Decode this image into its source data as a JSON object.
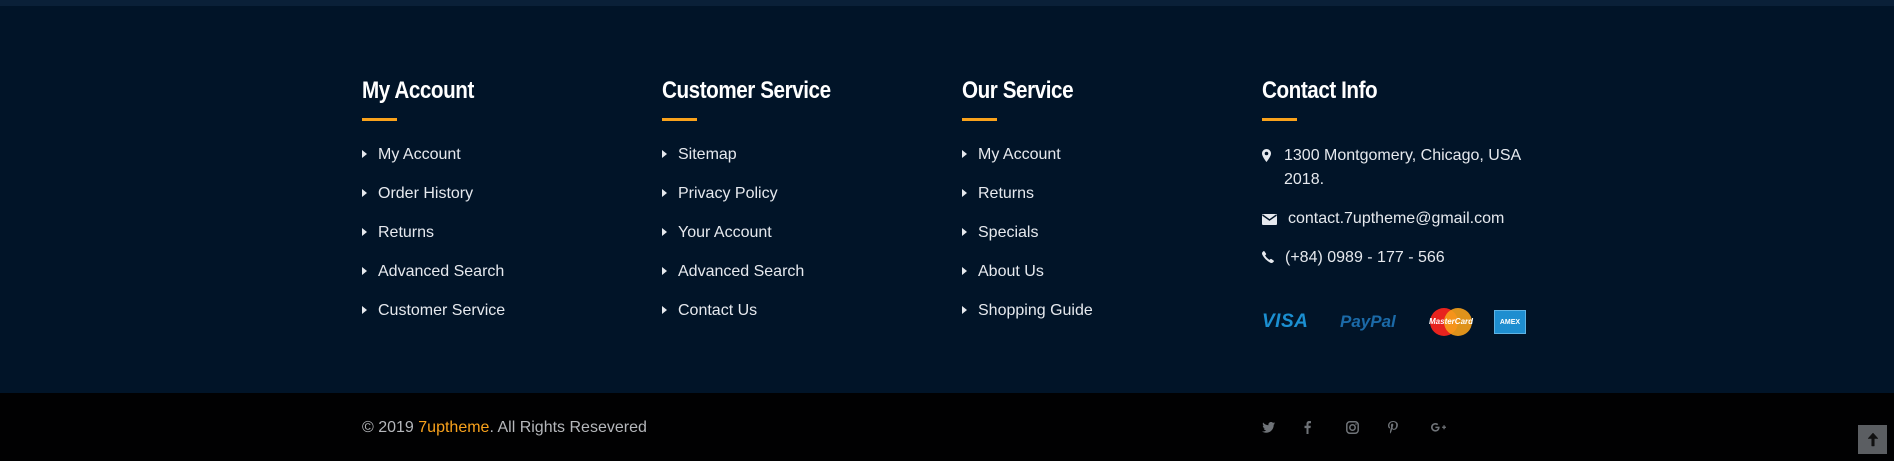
{
  "columns": [
    {
      "title": "My Account",
      "links": [
        "My Account",
        "Order History",
        "Returns",
        "Advanced Search",
        "Customer Service"
      ]
    },
    {
      "title": "Customer Service",
      "links": [
        "Sitemap",
        "Privacy Policy",
        "Your Account",
        "Advanced Search",
        "Contact Us"
      ]
    },
    {
      "title": "Our Service",
      "links": [
        "My Account",
        "Returns",
        "Specials",
        "About Us",
        "Shopping Guide"
      ]
    }
  ],
  "contact": {
    "title": "Contact Info",
    "address_line1": "1300 Montgomery, Chicago, USA",
    "address_line2": "2018.",
    "email": "contact.7uptheme@gmail.com",
    "phone": "(+84) 0989 - 177 - 566"
  },
  "payments": {
    "visa": "VISA",
    "paypal": "PayPal",
    "mastercard": "MasterCard",
    "amex": "AMEX"
  },
  "footer": {
    "copyright_prefix": "© 2019 ",
    "brand": "7uptheme",
    "copyright_suffix": ". All Rights Resevered"
  },
  "social_icons": [
    "twitter-icon",
    "facebook-icon",
    "instagram-icon",
    "pinterest-icon",
    "google-plus-icon"
  ],
  "colors": {
    "background": "#011428",
    "bottom_bar": "#010102",
    "accent": "#f9a21c"
  }
}
